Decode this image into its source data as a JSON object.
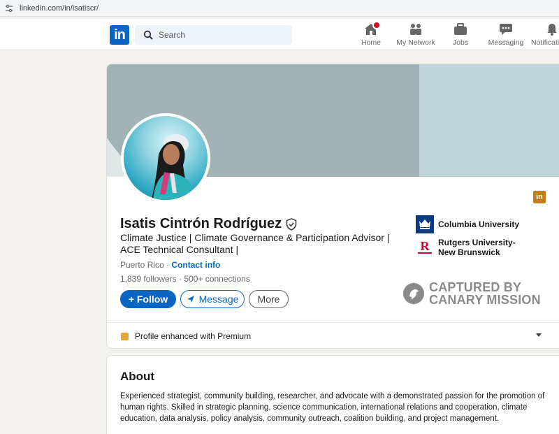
{
  "browser": {
    "url": "linkedin.com/in/isatiscr/"
  },
  "nav": {
    "logo": "in",
    "search_placeholder": "Search",
    "items": [
      {
        "label": "Home",
        "icon": "home-icon"
      },
      {
        "label": "My Network",
        "icon": "network-icon"
      },
      {
        "label": "Jobs",
        "icon": "briefcase-icon"
      },
      {
        "label": "Messaging",
        "icon": "messaging-icon"
      },
      {
        "label": "Notificati",
        "icon": "bell-icon"
      }
    ]
  },
  "profile": {
    "name": "Isatis Cintrón Rodríguez",
    "headline": "Climate Justice | Climate Governance & Participation Advisor | ACE Technical Consultant |",
    "location": "Puerto Rico",
    "location_sep": " · ",
    "contact_info": "Contact info",
    "followers": "1,839 followers",
    "connections": "500+ connections",
    "follow_label": "+ Follow",
    "message_label": "Message",
    "more_label": "More",
    "premium_icon_text": "in",
    "education": [
      {
        "name": "Columbia University",
        "icon": "columbia-logo-icon"
      },
      {
        "name": "Rutgers University-New Brunswick",
        "icon": "rutgers-logo-icon"
      }
    ],
    "premium_text": "Profile enhanced with Premium"
  },
  "watermark": {
    "line1": "CAPTURED BY",
    "line2": "CANARY MISSION"
  },
  "about": {
    "title": "About",
    "text": "Experienced strategist, community building, researcher, and advocate with a demonstrated passion for the promotion of human rights. Skilled in strategic planning, science communication, international relations and cooperation, climate education, data analysis, policy analysis, community outreach, coalition building, and project management."
  },
  "colors": {
    "brand": "#0a66c2",
    "badge": "#cb112d",
    "banner": "#a2b3b6",
    "premium": "#e7a33e"
  }
}
